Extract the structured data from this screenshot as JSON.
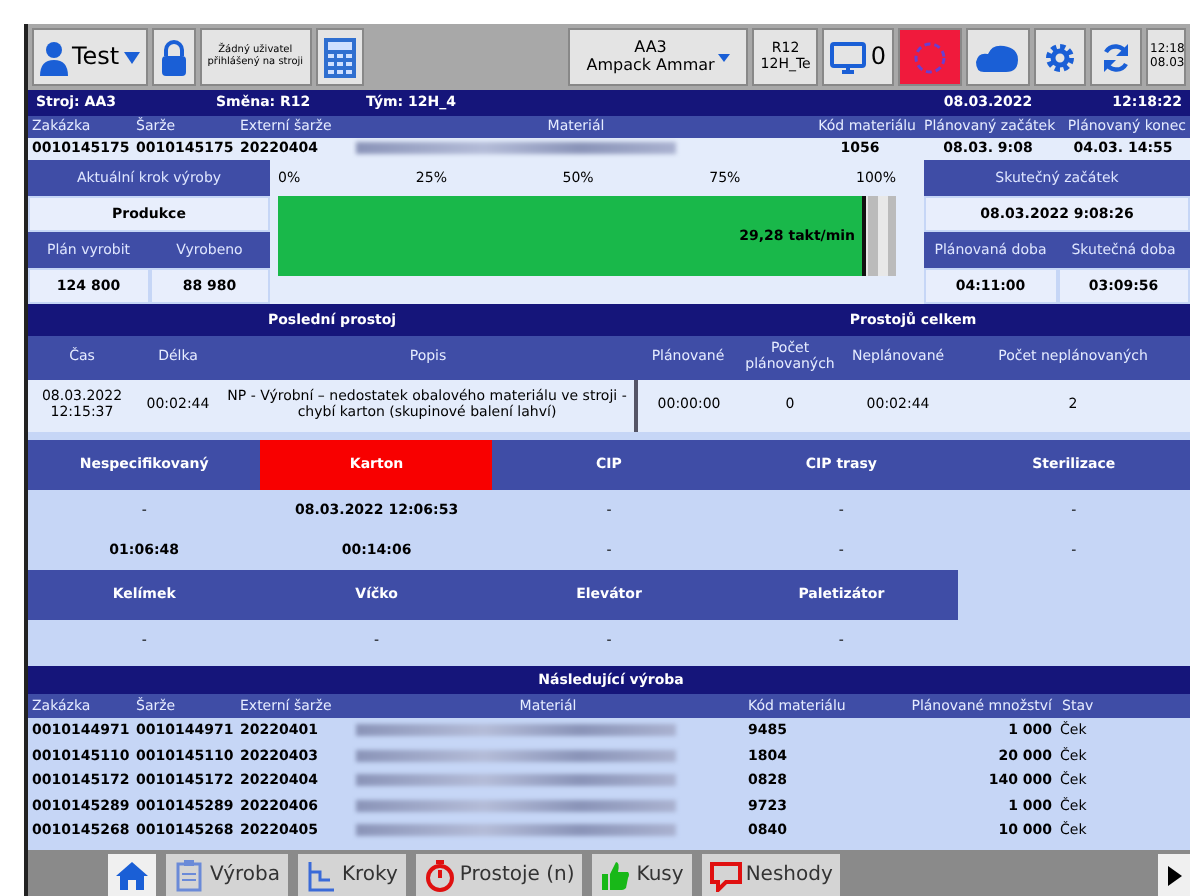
{
  "toolbar": {
    "user": "Test",
    "login_note": "Žádný uživatel přihlášený na stroji",
    "machine": {
      "code": "AA3",
      "name": "Ampack Ammar"
    },
    "shift": {
      "code": "R12",
      "team": "12H_Te"
    },
    "monitor_count": "0",
    "alarm_active": true,
    "time": "12:18",
    "date": "08.03"
  },
  "header": {
    "machine": "Stroj: AA3",
    "shift": "Směna: R12",
    "team": "Tým: 12H_4",
    "date": "08.03.2022",
    "time": "12:18:22"
  },
  "order": {
    "columns": [
      "Zakázka",
      "Šarže",
      "Externí šarže",
      "Materiál",
      "Kód materiálu",
      "Plánovaný začátek",
      "Plánovaný konec"
    ],
    "row": [
      {
        "text": "0010145175"
      },
      {
        "text": "0010145175"
      },
      {
        "text": "20220404"
      },
      {
        "kind": "blurred"
      },
      {
        "text": "1056"
      },
      {
        "text": "08.03. 9:08"
      },
      {
        "text": "04.03. 14:55"
      }
    ]
  },
  "step": {
    "label": "Aktuální krok výroby",
    "value": "Produkce",
    "plan_label": "Plán vyrobit",
    "made_label": "Vyrobeno",
    "plan": "124 800",
    "made": "88 980"
  },
  "progress": {
    "ticks": [
      "0%",
      "25%",
      "50%",
      "75%",
      "100%"
    ],
    "level": 0.95,
    "reading": "29,28 takt/min"
  },
  "timing": {
    "start_label": "Skutečný začátek",
    "start": "08.03.2022 9:08:26",
    "planned_label": "Plánovaná doba",
    "actual_label": "Skutečná doba",
    "planned": "04:11:00",
    "actual": "03:09:56"
  },
  "downtime": {
    "title": "Poslední prostoj",
    "totals_title": "Prostojů celkem",
    "columns": [
      "Čas",
      "Délka",
      "Popis",
      "Plánované",
      "Počet plánovaných",
      "Neplánované",
      "Počet neplánovaných"
    ],
    "row": [
      "08.03.2022 12:15:37",
      "00:02:44",
      "NP - Výrobní – nedostatek obalového materiálu ve stroji - chybí karton (skupinové balení lahví)",
      "00:00:00",
      "0",
      "00:02:44",
      "2"
    ]
  },
  "categories": [
    {
      "label": "Nespecifikovaný",
      "selected": false,
      "values": [
        "-",
        "01:06:48"
      ]
    },
    {
      "label": "Karton",
      "selected": true,
      "values": [
        "08.03.2022 12:06:53",
        "00:14:06"
      ]
    },
    {
      "label": "CIP",
      "selected": false,
      "values": [
        "-",
        "-"
      ]
    },
    {
      "label": "CIP trasy",
      "selected": false,
      "values": [
        "-",
        "-"
      ]
    },
    {
      "label": "Sterilizace",
      "selected": false,
      "values": [
        "-",
        "-"
      ]
    }
  ],
  "categories_2": [
    {
      "label": "Kelímek",
      "selected": false,
      "values": [
        "-"
      ]
    },
    {
      "label": "Víčko",
      "selected": false,
      "values": [
        "-"
      ]
    },
    {
      "label": "Elevátor",
      "selected": false,
      "values": [
        "-"
      ]
    },
    {
      "label": "Paletizátor",
      "selected": false,
      "values": [
        "-"
      ]
    }
  ],
  "next_production": {
    "title": "Následující výroba",
    "columns": [
      "Zakázka",
      "Šarže",
      "Externí šarže",
      "Materiál",
      "Kód materiálu",
      "Plánované množství",
      "Stav"
    ],
    "rows": [
      [
        "0010144971",
        "0010144971",
        "20220401",
        {
          "kind": "blurred"
        },
        "9485",
        "1 000",
        "Ček"
      ],
      [
        "0010145110",
        "0010145110",
        "20220403",
        {
          "kind": "blurred"
        },
        "1804",
        "20 000",
        "Ček"
      ],
      [
        "0010145172",
        "0010145172",
        "20220404",
        {
          "kind": "blurred"
        },
        "0828",
        "140 000",
        "Ček"
      ],
      [
        "0010145289",
        "0010145289",
        "20220406",
        {
          "kind": "blurred"
        },
        "9723",
        "1 000",
        "Ček"
      ],
      [
        "0010145268",
        "0010145268",
        "20220405",
        {
          "kind": "blurred"
        },
        "0840",
        "10 000",
        "Ček"
      ]
    ]
  },
  "tabs": [
    {
      "kind": "home",
      "selected": true
    },
    {
      "kind": "production",
      "label": "Výroba",
      "selected": false
    },
    {
      "kind": "steps",
      "label": "Kroky",
      "selected": false
    },
    {
      "kind": "downtime",
      "label": "Prostoje (n)",
      "selected": false
    },
    {
      "kind": "pieces",
      "label": "Kusy",
      "selected": false
    },
    {
      "kind": "defects",
      "label": "Neshody",
      "selected": false
    }
  ]
}
